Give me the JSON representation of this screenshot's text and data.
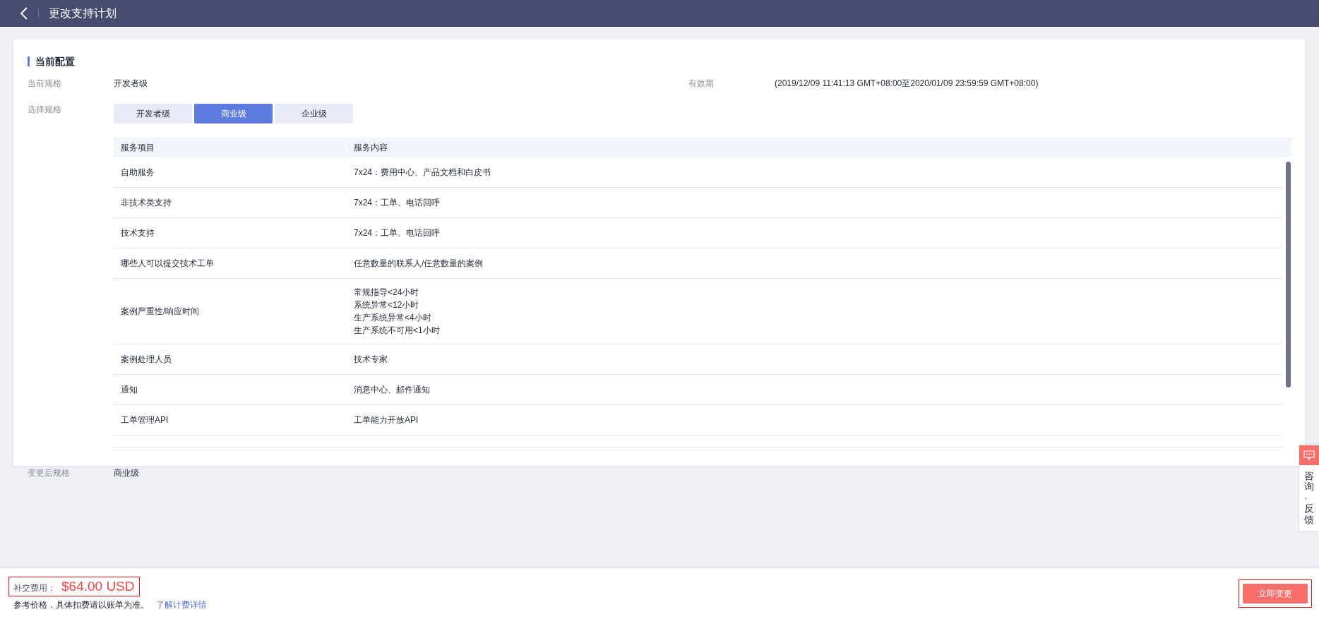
{
  "header": {
    "title": "更改支持计划"
  },
  "section": {
    "title": "当前配置"
  },
  "current": {
    "label": "当前规格",
    "value": "开发者级",
    "validity_label": "有效期",
    "validity": "(2019/12/09 11:41:13 GMT+08:00至2020/01/09 23:59:59 GMT+08:00)"
  },
  "select": {
    "label": "选择规格",
    "options": [
      {
        "label": "开发者级",
        "selected": false
      },
      {
        "label": "商业级",
        "selected": true
      },
      {
        "label": "企业级",
        "selected": false
      }
    ]
  },
  "table": {
    "columns": [
      "服务项目",
      "服务内容"
    ],
    "rows": [
      {
        "item": "自助服务",
        "content": [
          "7x24：费用中心、产品文档和白皮书"
        ]
      },
      {
        "item": "非技术类支持",
        "content": [
          "7x24：工单、电话回呼"
        ]
      },
      {
        "item": "技术支持",
        "content": [
          "7x24：工单、电话回呼"
        ]
      },
      {
        "item": "哪些人可以提交技术工单",
        "content": [
          "任意数量的联系人/任意数量的案例"
        ]
      },
      {
        "item": "案例严重性/响应时间",
        "content": [
          "常规指导<24小时",
          "系统异常<12小时",
          "生产系统异常<4小时",
          "生产系统不可用<1小时"
        ]
      },
      {
        "item": "案例处理人员",
        "content": [
          "技术专家"
        ]
      },
      {
        "item": "通知",
        "content": [
          "消息中心、邮件通知"
        ]
      },
      {
        "item": "工单管理API",
        "content": [
          "工单能力开放API"
        ]
      }
    ]
  },
  "after": {
    "label": "变更后规格",
    "value": "商业级"
  },
  "feedback": {
    "label": "咨询·反馈"
  },
  "footer": {
    "fee_label": "补交费用：",
    "fee": "$64.00 USD",
    "note": "参考价格，具体扣费请以账单为准。",
    "link": "了解计费详情",
    "button": "立即变更"
  }
}
